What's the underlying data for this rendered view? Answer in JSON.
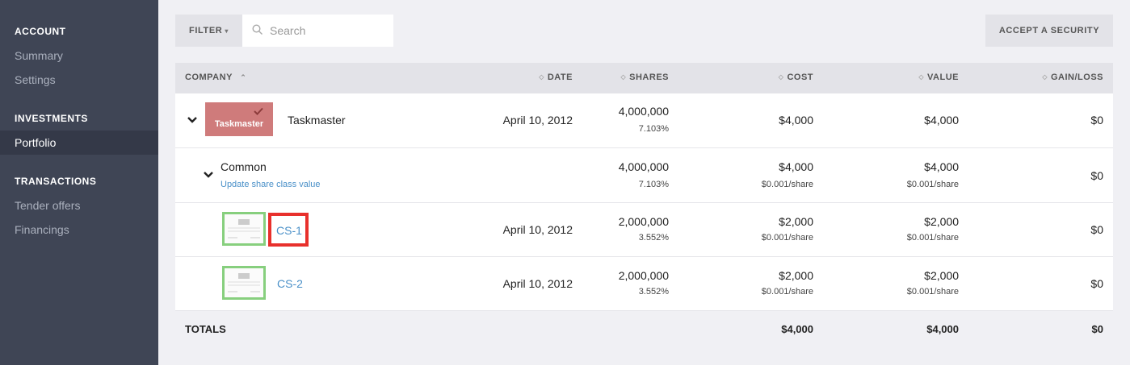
{
  "sidebar": {
    "sections": [
      {
        "title": "ACCOUNT",
        "items": [
          "Summary",
          "Settings"
        ]
      },
      {
        "title": "INVESTMENTS",
        "items": [
          "Portfolio"
        ]
      },
      {
        "title": "TRANSACTIONS",
        "items": [
          "Tender offers",
          "Financings"
        ]
      }
    ],
    "active_item": "Portfolio"
  },
  "toolbar": {
    "filter_label": "FILTER",
    "search_placeholder": "Search",
    "accept_label": "ACCEPT A SECURITY"
  },
  "table": {
    "columns": [
      "COMPANY",
      "DATE",
      "SHARES",
      "COST",
      "VALUE",
      "GAIN/LOSS"
    ],
    "company_row": {
      "logo_text": "Taskmaster",
      "name": "Taskmaster",
      "date": "April 10, 2012",
      "shares": "4,000,000",
      "shares_pct": "7.103%",
      "cost": "$4,000",
      "value": "$4,000",
      "gain": "$0"
    },
    "class_row": {
      "name": "Common",
      "link": "Update share class value",
      "shares": "4,000,000",
      "shares_pct": "7.103%",
      "cost": "$4,000",
      "cost_per": "$0.001/share",
      "value": "$4,000",
      "value_per": "$0.001/share",
      "gain": "$0"
    },
    "certificates": [
      {
        "name": "CS-1",
        "date": "April 10, 2012",
        "shares": "2,000,000",
        "shares_pct": "3.552%",
        "cost": "$2,000",
        "cost_per": "$0.001/share",
        "value": "$2,000",
        "value_per": "$0.001/share",
        "gain": "$0"
      },
      {
        "name": "CS-2",
        "date": "April 10, 2012",
        "shares": "2,000,000",
        "shares_pct": "3.552%",
        "cost": "$2,000",
        "cost_per": "$0.001/share",
        "value": "$2,000",
        "value_per": "$0.001/share",
        "gain": "$0"
      }
    ],
    "totals": {
      "label": "TOTALS",
      "cost": "$4,000",
      "value": "$4,000",
      "gain": "$0"
    }
  },
  "colors": {
    "sidebar_bg": "#3f4555",
    "link": "#4a90c8",
    "highlight": "#e8302c",
    "logo_bg": "#cf7b7b",
    "cert_border": "#87cf7e"
  }
}
